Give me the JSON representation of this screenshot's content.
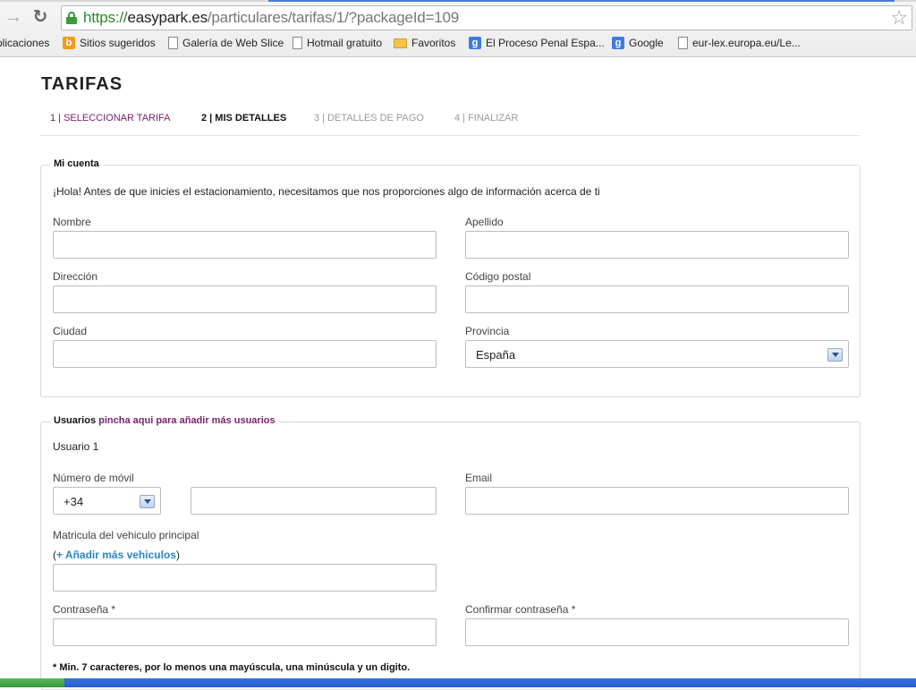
{
  "browser": {
    "url_protocol": "https://",
    "url_host": "easypark.es",
    "url_path": "/particulares/tarifas/1/?packageId=109",
    "bookmarks": [
      {
        "label": "plicaciones",
        "icon": "apps-icon"
      },
      {
        "label": "Sitios sugeridos",
        "icon": "bing-icon"
      },
      {
        "label": "Galería de Web Slice",
        "icon": "page-icon"
      },
      {
        "label": "Hotmail gratuito",
        "icon": "page-icon"
      },
      {
        "label": "Favoritos",
        "icon": "folder-icon"
      },
      {
        "label": "El Proceso Penal Espa...",
        "icon": "google-icon"
      },
      {
        "label": "Google",
        "icon": "google-icon"
      },
      {
        "label": "eur-lex.europa.eu/Le...",
        "icon": "page-icon"
      }
    ]
  },
  "page": {
    "title": "TARIFAS",
    "steps": [
      "1 | SELECCIONAR TARIFA",
      "2 | MIS DETALLES",
      "3 | DETALLES DE PAGO",
      "4 | FINALIZAR"
    ],
    "active_step": 2
  },
  "account": {
    "legend": "Mi cuenta",
    "intro": "¡Hola! Antes de que inicies el estacionamiento, necesitamos que nos proporciones algo de información acerca de ti",
    "labels": {
      "nombre": "Nombre",
      "apellido": "Apellido",
      "direccion": "Dirección",
      "codigo_postal": "Código postal",
      "ciudad": "Ciudad",
      "provincia": "Provincia"
    },
    "provincia_value": "España"
  },
  "users": {
    "legend": "Usuarios",
    "add_link": "pincha aqui para añadir más usuarios",
    "user_title": "Usuario 1",
    "labels": {
      "movil": "Número de móvil",
      "email": "Email",
      "matricula": "Matricula del vehiculo principal",
      "password": "Contraseña *",
      "confirm_password": "Confirmar contraseña *"
    },
    "prefix_value": "+34",
    "add_vehicle_open": "(",
    "add_vehicle_link": "+ Añadir más vehiculos",
    "add_vehicle_close": ")",
    "password_note": "* Min. 7 caracteres, por lo menos una mayúscula, una minúscula y un digito."
  },
  "colors": {
    "step_done": "#7a1f6e",
    "link_blue": "#2b86c5",
    "url_green": "#2d8a2d"
  }
}
